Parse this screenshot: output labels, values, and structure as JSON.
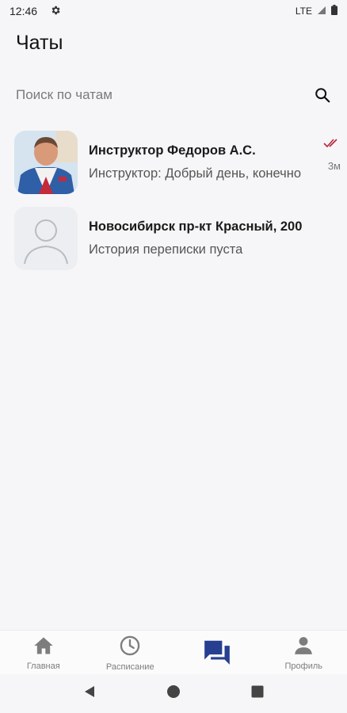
{
  "status_bar": {
    "time": "12:46",
    "network": "LTE"
  },
  "header": {
    "title": "Чаты"
  },
  "search": {
    "placeholder": "Поиск по чатам"
  },
  "chats": [
    {
      "name": "Инструктор Федоров А.С.",
      "preview": "Инструктор: Добрый день, конечно",
      "time": "3м",
      "read_ticks": "✓✓",
      "tick_color": "#b3263a"
    },
    {
      "name": "Новосибирск пр-кт Красный, 200",
      "preview": "История переписки пуста"
    }
  ],
  "bottom_nav": [
    {
      "label": "Главная",
      "icon": "home-icon"
    },
    {
      "label": "Расписание",
      "icon": "clock-icon"
    },
    {
      "label": "",
      "icon": "chat-icon",
      "active": true
    },
    {
      "label": "Профиль",
      "icon": "person-icon"
    }
  ],
  "colors": {
    "accent": "#263f91",
    "background": "#f6f6f8"
  }
}
